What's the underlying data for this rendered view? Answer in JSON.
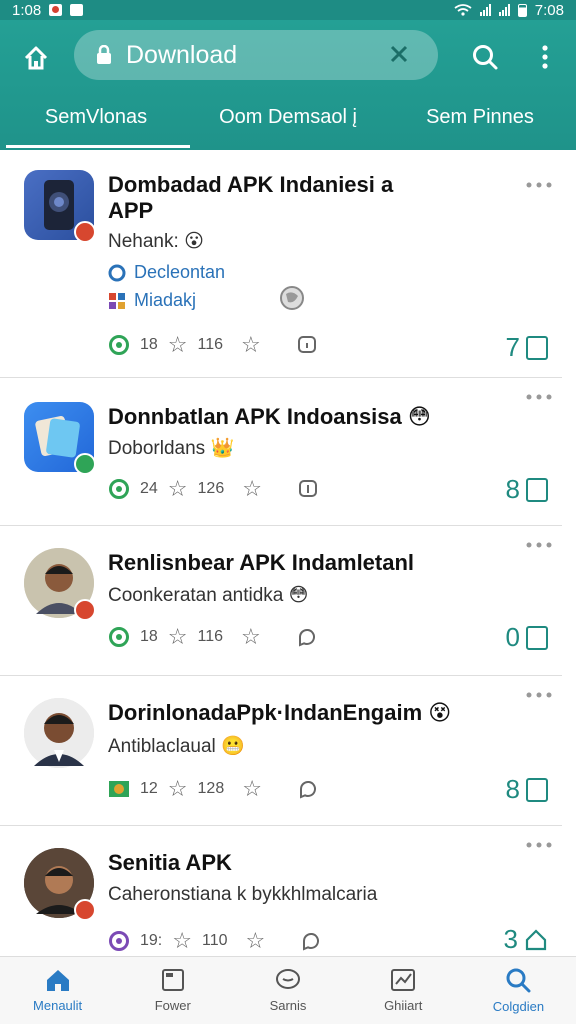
{
  "status": {
    "time_left": "1:08",
    "time_right": "7:08"
  },
  "appbar": {
    "search_text": "Download"
  },
  "tabs": [
    {
      "label": "SemVlonas",
      "active": true
    },
    {
      "label": "Oom Demsaol į",
      "active": false
    },
    {
      "label": "Sem Pinnes",
      "active": false
    }
  ],
  "items": [
    {
      "title": "Dombadad APK Indaniesi a APP",
      "subtitle": "Nehank:",
      "tags": [
        "Decleontan",
        "Miadakj"
      ],
      "stat_a": "18",
      "stat_b": "116",
      "count": "7",
      "icon": "phone-app-icon",
      "badge_color": "#d7472f"
    },
    {
      "title": "Donnbatlan APK Indoansiѕa",
      "subtitle": "Doborldans",
      "tags": [],
      "stat_a": "24",
      "stat_b": "126",
      "count": "8",
      "icon": "gallery-app-icon",
      "badge_color": "#2fa457"
    },
    {
      "title": "Renlisnbear APK Indamletanl",
      "subtitle": "Coonkeratan antidka",
      "tags": [],
      "stat_a": "18",
      "stat_b": "116",
      "count": "0",
      "icon": "person-avatar",
      "badge_color": "#d7472f"
    },
    {
      "title": "DorinlonadaPpk·IndanEngaim",
      "subtitle": "Antiblaclaual",
      "tags": [],
      "stat_a": "12",
      "stat_b": "128",
      "count": "8",
      "icon": "person-avatar",
      "badge_color": null
    },
    {
      "title": "Senitia APK",
      "subtitle": "Caheronstiana k bykkhlmalcaria",
      "tags": [],
      "stat_a": "19:",
      "stat_b": "110",
      "count": "3",
      "icon": "person-avatar",
      "badge_color": "#d7472f"
    }
  ],
  "bottom_nav": [
    {
      "label": "Menaulit",
      "icon": "home-icon",
      "active": true
    },
    {
      "label": "Fower",
      "icon": "window-icon",
      "active": false
    },
    {
      "label": "Sarnis",
      "icon": "chat-icon",
      "active": false
    },
    {
      "label": "Ghiiart",
      "icon": "chart-icon",
      "active": false
    },
    {
      "label": "Colgdien",
      "icon": "search-icon",
      "active": true
    }
  ],
  "colors": {
    "teal": "#1f938a",
    "accent_blue": "#2a7bc4",
    "count_green": "#1f8a80"
  }
}
